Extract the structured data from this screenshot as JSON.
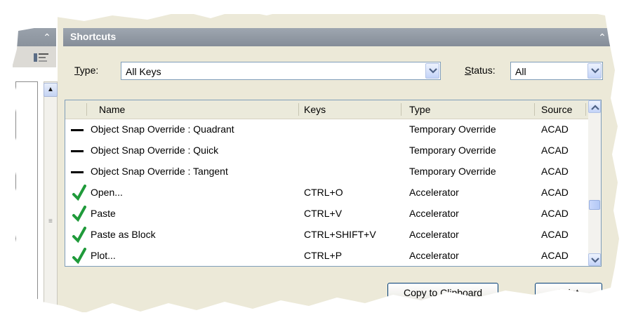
{
  "panel": {
    "title": "Shortcuts"
  },
  "filters": {
    "type_label_u": "T",
    "type_label_rest": "ype:",
    "type_value": "All Keys",
    "status_label_u": "S",
    "status_label_rest": "tatus:",
    "status_value": "All"
  },
  "table": {
    "columns": [
      "Name",
      "Keys",
      "Type",
      "Source"
    ],
    "rows": [
      {
        "icon": "dash",
        "name": "Object Snap Override : Quadrant",
        "keys": "",
        "type": "Temporary Override",
        "source": "ACAD"
      },
      {
        "icon": "dash",
        "name": "Object Snap Override : Quick",
        "keys": "",
        "type": "Temporary Override",
        "source": "ACAD"
      },
      {
        "icon": "dash",
        "name": "Object Snap Override : Tangent",
        "keys": "",
        "type": "Temporary Override",
        "source": "ACAD"
      },
      {
        "icon": "check",
        "name": "Open...",
        "keys": "CTRL+O",
        "type": "Accelerator",
        "source": "ACAD"
      },
      {
        "icon": "check",
        "name": "Paste",
        "keys": "CTRL+V",
        "type": "Accelerator",
        "source": "ACAD"
      },
      {
        "icon": "check",
        "name": "Paste as Block",
        "keys": "CTRL+SHIFT+V",
        "type": "Accelerator",
        "source": "ACAD"
      },
      {
        "icon": "check",
        "name": "Plot...",
        "keys": "CTRL+P",
        "type": "Accelerator",
        "source": "ACAD"
      }
    ]
  },
  "buttons": {
    "copy": "Copy to Clipboard",
    "print_u": "P",
    "print_rest": "rint"
  },
  "colors": {
    "header": "#8f97a2",
    "check": "#1f9a3a",
    "panel_bg": "#ece9d8"
  }
}
